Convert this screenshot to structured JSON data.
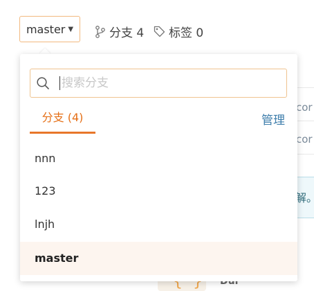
{
  "toolbar": {
    "current_branch": "master",
    "branches_label": "分支 4",
    "tags_label": "标签 0"
  },
  "background": {
    "rows": [
      "cor",
      "cor"
    ],
    "notice": "解。",
    "partial_text": "Dul"
  },
  "dropdown": {
    "search": {
      "placeholder": "搜索分支",
      "value": ""
    },
    "tab_label": "分支 (4)",
    "manage_label": "管理",
    "branches": [
      {
        "name": "nnn",
        "current": false
      },
      {
        "name": "123",
        "current": false
      },
      {
        "name": "lnjh",
        "current": false
      },
      {
        "name": "master",
        "current": true
      }
    ]
  },
  "colors": {
    "accent": "#e8772a",
    "active_item_bg": "#fdf5ef",
    "link": "#3d7dab"
  },
  "icons": [
    "caret-down-icon",
    "branch-icon",
    "tag-icon",
    "search-icon"
  ]
}
